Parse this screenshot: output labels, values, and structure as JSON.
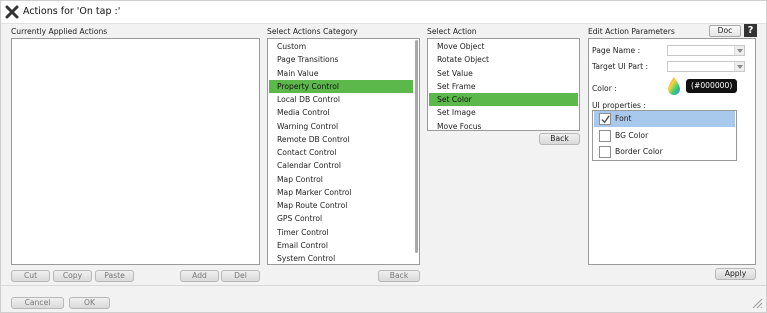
{
  "window": {
    "title": "Actions for 'On tap :'"
  },
  "applied": {
    "heading": "Currently Applied Actions"
  },
  "applied_buttons": {
    "cut": "Cut",
    "copy": "Copy",
    "paste": "Paste",
    "add": "Add",
    "del": "Del"
  },
  "category": {
    "heading": "Select Actions Category",
    "items": [
      "Custom",
      "Page Transitions",
      "Main Value",
      "Property Control",
      "Local DB Control",
      "Media Control",
      "Warning Control",
      "Remote DB Control",
      "Contact Control",
      "Calendar Control",
      "Map Control",
      "Map Marker Control",
      "Map Route Control",
      "GPS Control",
      "Timer Control",
      "Email Control",
      "System Control"
    ],
    "selected": "Property Control",
    "back": "Back"
  },
  "action": {
    "heading": "Select Action",
    "items": [
      "Move Object",
      "Rotate Object",
      "Set Value",
      "Set Frame",
      "Set Color",
      "Set Image",
      "Move Focus"
    ],
    "selected": "Set Color",
    "back": "Back"
  },
  "params": {
    "heading": "Edit Action Parameters",
    "doc": "Doc",
    "help": "?",
    "page_name_label": "Page Name :",
    "page_name_value": "",
    "target_label": "Target UI Part :",
    "target_value": "",
    "color_label": "Color :",
    "color_value": "(#000000)",
    "ui_props_label": "UI properties :",
    "ui_props": [
      {
        "label": "Font",
        "checked": true
      },
      {
        "label": "BG Color",
        "checked": false
      },
      {
        "label": "Border Color",
        "checked": false
      }
    ],
    "apply": "Apply"
  },
  "footer": {
    "cancel": "Cancel",
    "ok": "OK"
  },
  "colors": {
    "selection": "#5cb84a",
    "ui_selection": "#a9c9ec",
    "chip": "#111111"
  }
}
